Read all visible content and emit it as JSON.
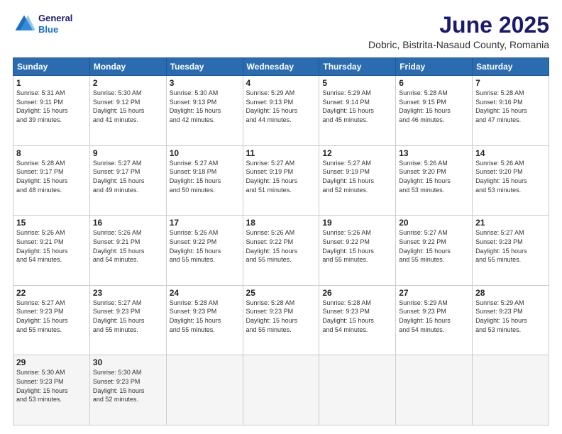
{
  "header": {
    "logo_line1": "General",
    "logo_line2": "Blue",
    "title": "June 2025",
    "subtitle": "Dobric, Bistrita-Nasaud County, Romania"
  },
  "weekdays": [
    "Sunday",
    "Monday",
    "Tuesday",
    "Wednesday",
    "Thursday",
    "Friday",
    "Saturday"
  ],
  "weeks": [
    [
      {
        "day": "1",
        "info": "Sunrise: 5:31 AM\nSunset: 9:11 PM\nDaylight: 15 hours\nand 39 minutes."
      },
      {
        "day": "2",
        "info": "Sunrise: 5:30 AM\nSunset: 9:12 PM\nDaylight: 15 hours\nand 41 minutes."
      },
      {
        "day": "3",
        "info": "Sunrise: 5:30 AM\nSunset: 9:13 PM\nDaylight: 15 hours\nand 42 minutes."
      },
      {
        "day": "4",
        "info": "Sunrise: 5:29 AM\nSunset: 9:13 PM\nDaylight: 15 hours\nand 44 minutes."
      },
      {
        "day": "5",
        "info": "Sunrise: 5:29 AM\nSunset: 9:14 PM\nDaylight: 15 hours\nand 45 minutes."
      },
      {
        "day": "6",
        "info": "Sunrise: 5:28 AM\nSunset: 9:15 PM\nDaylight: 15 hours\nand 46 minutes."
      },
      {
        "day": "7",
        "info": "Sunrise: 5:28 AM\nSunset: 9:16 PM\nDaylight: 15 hours\nand 47 minutes."
      }
    ],
    [
      {
        "day": "8",
        "info": "Sunrise: 5:28 AM\nSunset: 9:17 PM\nDaylight: 15 hours\nand 48 minutes."
      },
      {
        "day": "9",
        "info": "Sunrise: 5:27 AM\nSunset: 9:17 PM\nDaylight: 15 hours\nand 49 minutes."
      },
      {
        "day": "10",
        "info": "Sunrise: 5:27 AM\nSunset: 9:18 PM\nDaylight: 15 hours\nand 50 minutes."
      },
      {
        "day": "11",
        "info": "Sunrise: 5:27 AM\nSunset: 9:19 PM\nDaylight: 15 hours\nand 51 minutes."
      },
      {
        "day": "12",
        "info": "Sunrise: 5:27 AM\nSunset: 9:19 PM\nDaylight: 15 hours\nand 52 minutes."
      },
      {
        "day": "13",
        "info": "Sunrise: 5:26 AM\nSunset: 9:20 PM\nDaylight: 15 hours\nand 53 minutes."
      },
      {
        "day": "14",
        "info": "Sunrise: 5:26 AM\nSunset: 9:20 PM\nDaylight: 15 hours\nand 53 minutes."
      }
    ],
    [
      {
        "day": "15",
        "info": "Sunrise: 5:26 AM\nSunset: 9:21 PM\nDaylight: 15 hours\nand 54 minutes."
      },
      {
        "day": "16",
        "info": "Sunrise: 5:26 AM\nSunset: 9:21 PM\nDaylight: 15 hours\nand 54 minutes."
      },
      {
        "day": "17",
        "info": "Sunrise: 5:26 AM\nSunset: 9:22 PM\nDaylight: 15 hours\nand 55 minutes."
      },
      {
        "day": "18",
        "info": "Sunrise: 5:26 AM\nSunset: 9:22 PM\nDaylight: 15 hours\nand 55 minutes."
      },
      {
        "day": "19",
        "info": "Sunrise: 5:26 AM\nSunset: 9:22 PM\nDaylight: 15 hours\nand 55 minutes."
      },
      {
        "day": "20",
        "info": "Sunrise: 5:27 AM\nSunset: 9:22 PM\nDaylight: 15 hours\nand 55 minutes."
      },
      {
        "day": "21",
        "info": "Sunrise: 5:27 AM\nSunset: 9:23 PM\nDaylight: 15 hours\nand 55 minutes."
      }
    ],
    [
      {
        "day": "22",
        "info": "Sunrise: 5:27 AM\nSunset: 9:23 PM\nDaylight: 15 hours\nand 55 minutes."
      },
      {
        "day": "23",
        "info": "Sunrise: 5:27 AM\nSunset: 9:23 PM\nDaylight: 15 hours\nand 55 minutes."
      },
      {
        "day": "24",
        "info": "Sunrise: 5:28 AM\nSunset: 9:23 PM\nDaylight: 15 hours\nand 55 minutes."
      },
      {
        "day": "25",
        "info": "Sunrise: 5:28 AM\nSunset: 9:23 PM\nDaylight: 15 hours\nand 55 minutes."
      },
      {
        "day": "26",
        "info": "Sunrise: 5:28 AM\nSunset: 9:23 PM\nDaylight: 15 hours\nand 54 minutes."
      },
      {
        "day": "27",
        "info": "Sunrise: 5:29 AM\nSunset: 9:23 PM\nDaylight: 15 hours\nand 54 minutes."
      },
      {
        "day": "28",
        "info": "Sunrise: 5:29 AM\nSunset: 9:23 PM\nDaylight: 15 hours\nand 53 minutes."
      }
    ],
    [
      {
        "day": "29",
        "info": "Sunrise: 5:30 AM\nSunset: 9:23 PM\nDaylight: 15 hours\nand 53 minutes."
      },
      {
        "day": "30",
        "info": "Sunrise: 5:30 AM\nSunset: 9:23 PM\nDaylight: 15 hours\nand 52 minutes."
      },
      {
        "day": "",
        "info": ""
      },
      {
        "day": "",
        "info": ""
      },
      {
        "day": "",
        "info": ""
      },
      {
        "day": "",
        "info": ""
      },
      {
        "day": "",
        "info": ""
      }
    ]
  ]
}
